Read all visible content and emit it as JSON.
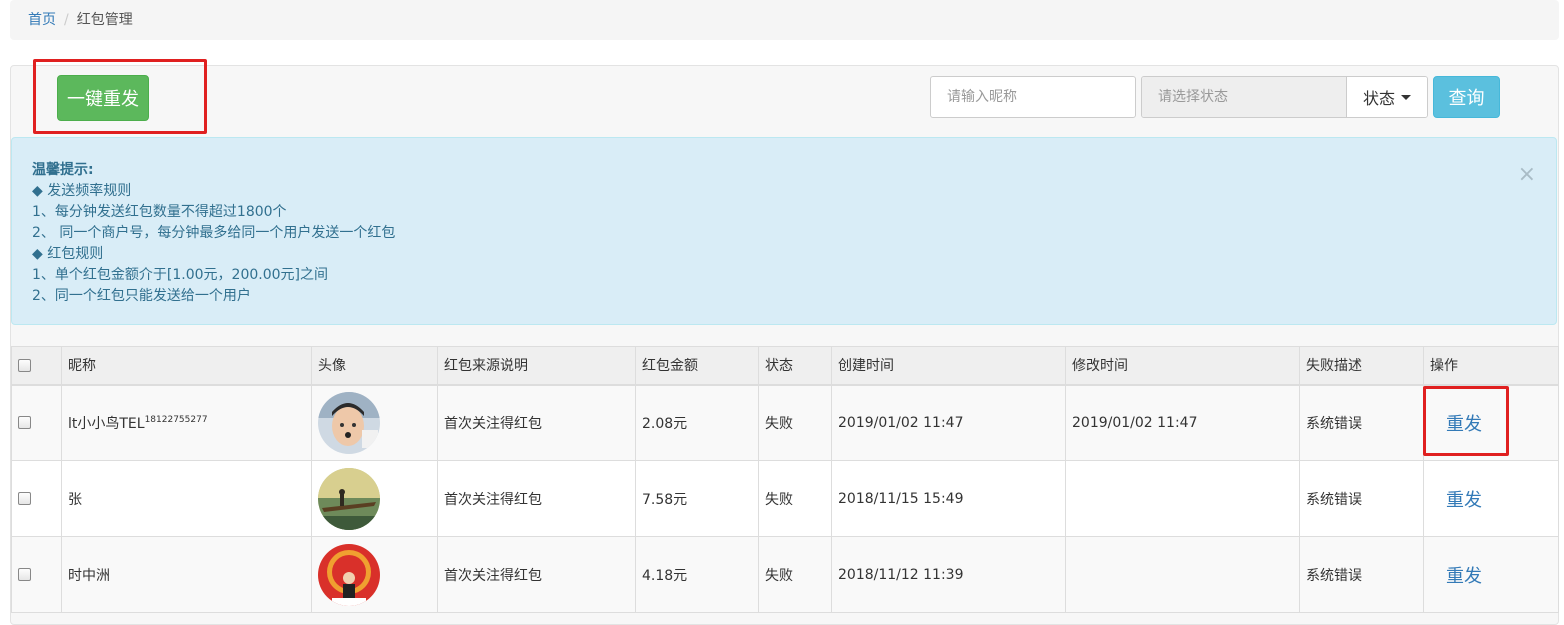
{
  "breadcrumb": {
    "home": "首页",
    "separator": "/",
    "current": "红包管理"
  },
  "toolbar": {
    "resend_all_label": "一键重发",
    "nickname_placeholder": "请输入昵称",
    "status_placeholder": "请选择状态",
    "status_button_label": "状态",
    "query_label": "查询"
  },
  "notice": {
    "title": "温馨提示:",
    "close_symbol": "×",
    "lines": [
      "◆ 发送频率规则",
      "1、每分钟发送红包数量不得超过1800个",
      "2、 同一个商户号，每分钟最多给同一个用户发送一个红包",
      "◆ 红包规则",
      "1、单个红包金额介于[1.00元，200.00元]之间",
      "2、同一个红包只能发送给一个用户"
    ]
  },
  "table": {
    "headers": [
      "昵称",
      "头像",
      "红包来源说明",
      "红包金额",
      "状态",
      "创建时间",
      "修改时间",
      "失败描述",
      "操作"
    ],
    "rows": [
      {
        "nickname": "lt小小鸟TEL",
        "nickname_sup": "18122755277",
        "source": "首次关注得红包",
        "amount": "2.08元",
        "status": "失败",
        "created": "2019/01/02 11:47",
        "modified": "2019/01/02 11:47",
        "fail_desc": "系统错误",
        "action": "重发"
      },
      {
        "nickname": "张",
        "nickname_sup": "",
        "source": "首次关注得红包",
        "amount": "7.58元",
        "status": "失败",
        "created": "2018/11/15 15:49",
        "modified": "",
        "fail_desc": "系统错误",
        "action": "重发"
      },
      {
        "nickname": "时中洲",
        "nickname_sup": "",
        "source": "首次关注得红包",
        "amount": "4.18元",
        "status": "失败",
        "created": "2018/11/12 11:39",
        "modified": "",
        "fail_desc": "系统错误",
        "action": "重发"
      }
    ]
  },
  "colors": {
    "success": "#5cb85c",
    "info": "#5bc0de",
    "link": "#337ab7",
    "highlight": "#e02020"
  }
}
